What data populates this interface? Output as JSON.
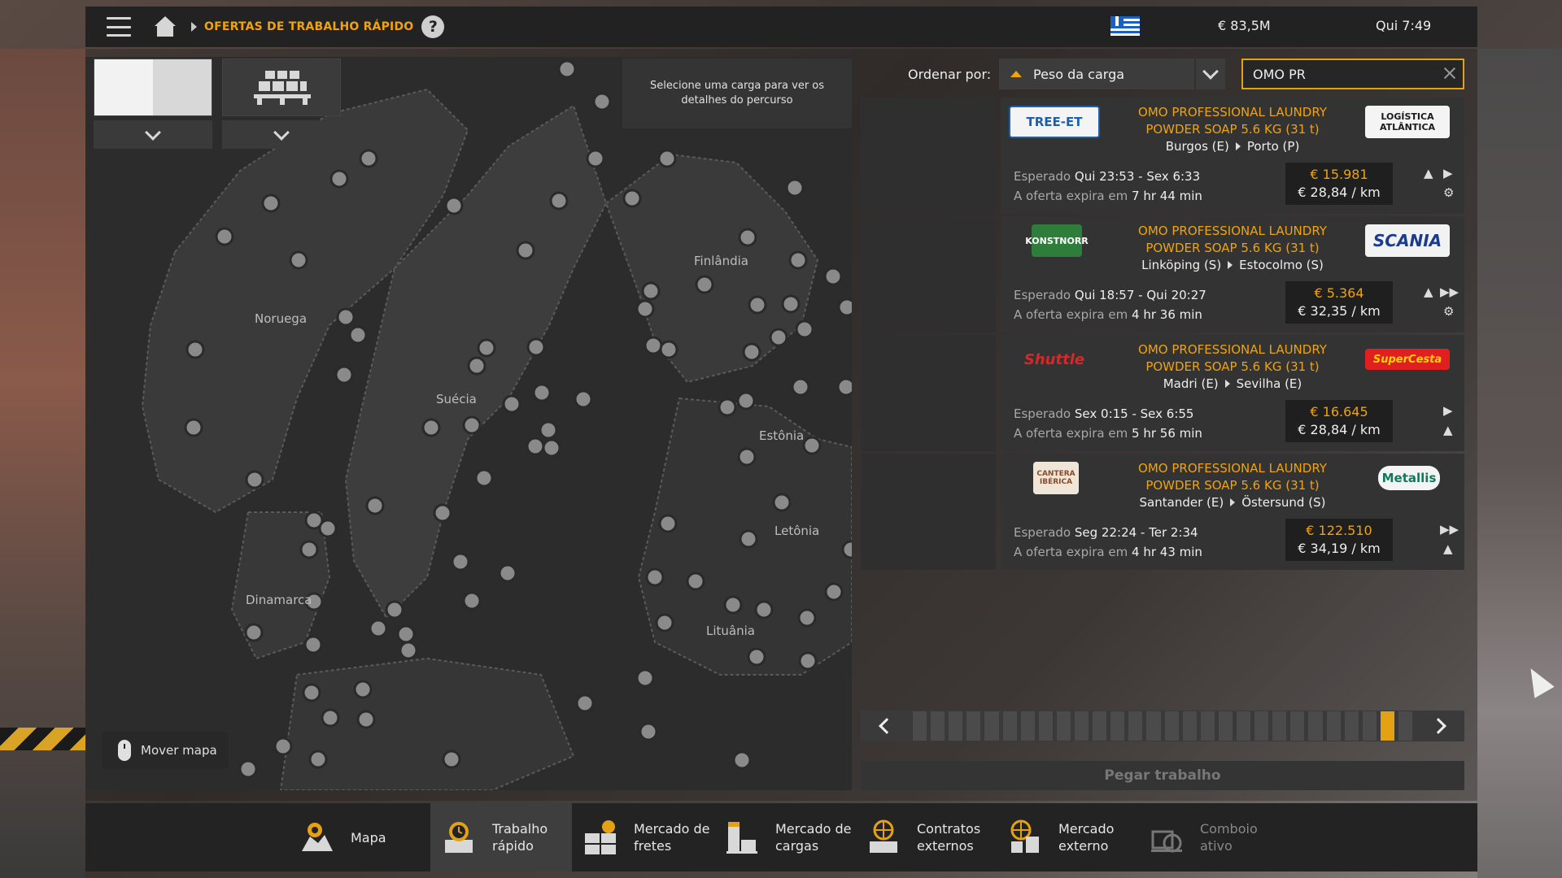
{
  "header": {
    "breadcrumb": "OFERTAS DE TRABALHO RÁPIDO",
    "help_icon_glyph": "?",
    "money": "€ 83,5M",
    "time": "Qui 7:49"
  },
  "map": {
    "hint": "Selecione uma carga para ver os detalhes do percurso",
    "labels": {
      "noruega": "Noruega",
      "suecia": "Suécia",
      "finlandia": "Finlândia",
      "estonia": "Estônia",
      "letonia": "Letônia",
      "lituania": "Lituânia",
      "dinamarca": "Dinamarca"
    },
    "move_map": "Mover mapa"
  },
  "sort": {
    "label": "Ordenar por:",
    "value": "Peso da carga",
    "search_value": "OMO PR"
  },
  "offers": [
    {
      "logo_left": "TREE-ET",
      "logo_right": "LOGÍSTICA ATLÂNTICA",
      "cargo_line1": "OMO PROFESSIONAL LAUNDRY",
      "cargo_line2": "POWDER SOAP 5.6 KG (31 t)",
      "from": "Burgos (E)",
      "to": "Porto (P)",
      "expected_label": "Esperado",
      "expected": "Qui 23:53 - Sex 6:33",
      "expires_label": "A oferta expira em",
      "expires": "7 hr 44 min",
      "price": "€ 15.981",
      "per_km": "€ 28,84 / km"
    },
    {
      "logo_left": "KONSTNORR",
      "logo_right": "SCANIA",
      "cargo_line1": "OMO PROFESSIONAL LAUNDRY",
      "cargo_line2": "POWDER SOAP 5.6 KG (31 t)",
      "from": "Linköping (S)",
      "to": "Estocolmo (S)",
      "expected_label": "Esperado",
      "expected": "Qui 18:57 - Qui 20:27",
      "expires_label": "A oferta expira em",
      "expires": "4 hr 36 min",
      "price": "€ 5.364",
      "per_km": "€ 32,35 / km"
    },
    {
      "logo_left": "Shuttle",
      "logo_right": "SuperCesta",
      "cargo_line1": "OMO PROFESSIONAL LAUNDRY",
      "cargo_line2": "POWDER SOAP 5.6 KG (31 t)",
      "from": "Madri (E)",
      "to": "Sevilha (E)",
      "expected_label": "Esperado",
      "expected": "Sex 0:15 - Sex 6:55",
      "expires_label": "A oferta expira em",
      "expires": "5 hr 56 min",
      "price": "€ 16.645",
      "per_km": "€ 28,84 / km"
    },
    {
      "logo_left": "CANTERA IBÉRICA",
      "logo_right": "Metallis",
      "cargo_line1": "OMO PROFESSIONAL LAUNDRY",
      "cargo_line2": "POWDER SOAP 5.6 KG (31 t)",
      "from": "Santander (E)",
      "to": "Östersund (S)",
      "expected_label": "Esperado",
      "expected": "Seg 22:24 - Ter 2:34",
      "expires_label": "A oferta expira em",
      "expires": "4 hr 43 min",
      "price": "€ 122.510",
      "per_km": "€ 34,19 / km"
    }
  ],
  "take_job": "Pegar trabalho",
  "bottom_tabs": [
    {
      "line1": "Mapa",
      "line2": ""
    },
    {
      "line1": "Trabalho",
      "line2": "rápido"
    },
    {
      "line1": "Mercado de",
      "line2": "fretes"
    },
    {
      "line1": "Mercado de",
      "line2": "cargas"
    },
    {
      "line1": "Contratos",
      "line2": "externos"
    },
    {
      "line1": "Mercado",
      "line2": "externo"
    },
    {
      "line1": "Comboio",
      "line2": "ativo"
    }
  ],
  "colors": {
    "accent": "#f0a30a",
    "panel": "#333333",
    "topbar": "#222222"
  }
}
